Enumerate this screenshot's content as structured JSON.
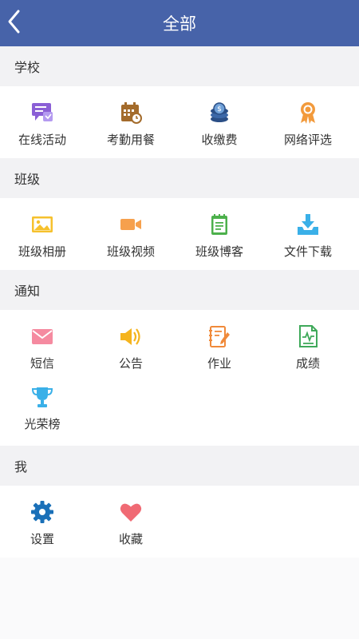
{
  "header": {
    "title": "全部"
  },
  "sections": [
    {
      "title": "学校",
      "items": [
        {
          "label": "在线活动",
          "icon": "chat-bubble-icon",
          "color": "#8b5fd6"
        },
        {
          "label": "考勤用餐",
          "icon": "calendar-clock-icon",
          "color": "#a36b2b"
        },
        {
          "label": "收缴费",
          "icon": "coin-stack-icon",
          "color": "#2b4f86"
        },
        {
          "label": "网络评选",
          "icon": "award-medal-icon",
          "color": "#f29a3c"
        }
      ]
    },
    {
      "title": "班级",
      "items": [
        {
          "label": "班级相册",
          "icon": "photo-icon",
          "color": "#f6c12d"
        },
        {
          "label": "班级视频",
          "icon": "video-camera-icon",
          "color": "#f6a04d"
        },
        {
          "label": "班级博客",
          "icon": "notepad-icon",
          "color": "#4cb04b"
        },
        {
          "label": "文件下载",
          "icon": "download-tray-icon",
          "color": "#3ab0e8"
        }
      ]
    },
    {
      "title": "通知",
      "items": [
        {
          "label": "短信",
          "icon": "envelope-icon",
          "color": "#f58aa0"
        },
        {
          "label": "公告",
          "icon": "speaker-icon",
          "color": "#f5b41d"
        },
        {
          "label": "作业",
          "icon": "notebook-pen-icon",
          "color": "#f08a3a"
        },
        {
          "label": "成绩",
          "icon": "report-chart-icon",
          "color": "#3fa95a"
        },
        {
          "label": "光荣榜",
          "icon": "trophy-icon",
          "color": "#3ab0e8"
        }
      ]
    },
    {
      "title": "我",
      "items": [
        {
          "label": "设置",
          "icon": "gear-icon",
          "color": "#1a70b8"
        },
        {
          "label": "收藏",
          "icon": "heart-icon",
          "color": "#f06a74"
        }
      ]
    }
  ]
}
